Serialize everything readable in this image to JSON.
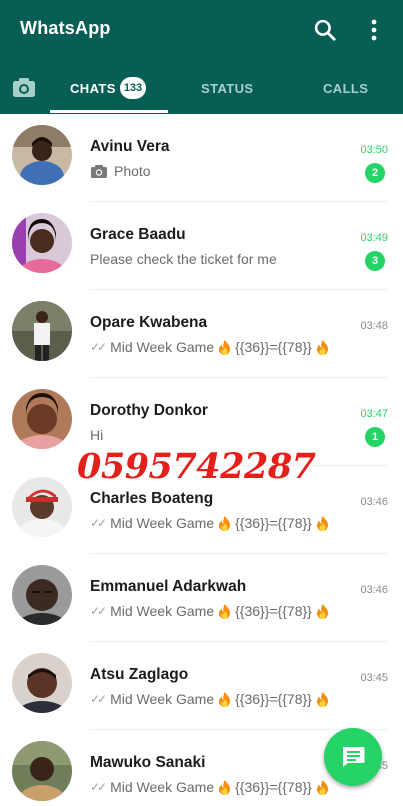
{
  "appbar": {
    "title": "WhatsApp",
    "background": "#075e54",
    "icons": [
      "search-icon",
      "more-vert-icon"
    ]
  },
  "tabs": {
    "camera_icon": "camera-icon",
    "items": [
      {
        "label": "CHATS",
        "active": true,
        "badge": "133"
      },
      {
        "label": "STATUS",
        "active": false
      },
      {
        "label": "CALLS",
        "active": false
      }
    ]
  },
  "chats": [
    {
      "name": "Avinu Vera",
      "preview": "Photo",
      "preview_icon": "camera-icon",
      "time": "03:50",
      "unread": "2"
    },
    {
      "name": "Grace Baadu",
      "preview": "Please check the ticket for me",
      "time": "03:49",
      "unread": "3"
    },
    {
      "name": "Opare Kwabena",
      "preview_parts": [
        "Mid Week Game",
        "{{36}}={{78}}"
      ],
      "ticks": "✓✓",
      "time": "03:48",
      "unread": ""
    },
    {
      "name": "Dorothy Donkor",
      "preview": "Hi",
      "time": "03:47",
      "unread": "1"
    },
    {
      "name": "Charles Boateng",
      "preview_parts": [
        "Mid Week Game",
        "{{36}}={{78}}"
      ],
      "ticks": "✓✓",
      "time": "03:46",
      "unread": ""
    },
    {
      "name": "Emmanuel Adarkwah",
      "preview_parts": [
        "Mid Week Game",
        "{{36}}={{78}}"
      ],
      "ticks": "✓✓",
      "time": "03:46",
      "unread": ""
    },
    {
      "name": "Atsu Zaglago",
      "preview_parts": [
        "Mid Week Game",
        "{{36}}={{78}}"
      ],
      "ticks": "✓✓",
      "time": "03:45",
      "unread": ""
    },
    {
      "name": "Mawuko Sanaki",
      "preview_parts": [
        "Mid Week Game",
        "{{36}}={{78}}"
      ],
      "ticks": "✓✓",
      "time": "03:45",
      "unread": ""
    }
  ],
  "overlay": {
    "phone": "0595742287",
    "color": "#e4201b"
  },
  "fab": {
    "icon": "new-chat-icon",
    "color": "#25d366"
  },
  "colors": {
    "unread_green": "#25d366",
    "tick_gray": "#9aa0a6"
  }
}
